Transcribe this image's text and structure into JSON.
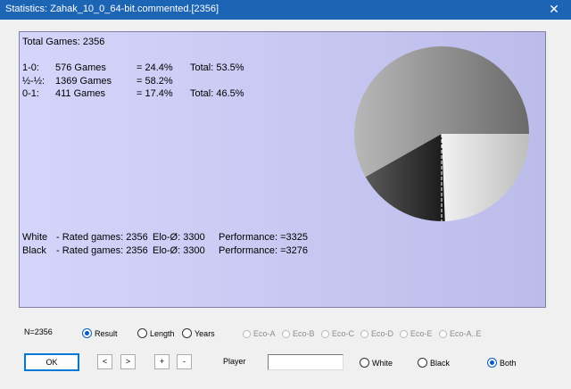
{
  "window": {
    "title": "Statistics: Zahak_10_0_64-bit.commented.[2356]",
    "close_label": "✕"
  },
  "stats": {
    "total_games": "Total Games: 2356",
    "rows": [
      {
        "result": "1-0:",
        "games": "576 Games",
        "pct": "= 24.4%",
        "total": "Total: 53.5%"
      },
      {
        "result": "½-½:",
        "games": "1369 Games",
        "pct": "= 58.2%",
        "total": ""
      },
      {
        "result": "0-1:",
        "games": "411 Games",
        "pct": "= 17.4%",
        "total": "Total: 46.5%"
      }
    ],
    "players": [
      {
        "side": "White",
        "rated": "- Rated games: 2356",
        "elo": "Elo-Ø: 3300",
        "perf": "Performance: =3325"
      },
      {
        "side": "Black",
        "rated": "- Rated games: 2356",
        "elo": "Elo-Ø: 3300",
        "perf": "Performance: =3276"
      }
    ]
  },
  "chart_data": {
    "type": "pie",
    "slices": [
      {
        "label": "1-0",
        "value": 24.4,
        "color": "#d9d9d9"
      },
      {
        "label": "0-1",
        "value": 17.4,
        "color": "#2e2e2e"
      },
      {
        "label": "½-½",
        "value": 58.2,
        "color": "#9a9a9a"
      }
    ]
  },
  "controls": {
    "count": "N=2356",
    "modes": [
      "Result",
      "Length",
      "Years"
    ],
    "mode_selected": "Result",
    "eco": [
      "Eco-A",
      "Eco-B",
      "Eco-C",
      "Eco-D",
      "Eco-E",
      "Eco-A..E"
    ],
    "ok": "OK",
    "prev": "<",
    "next": ">",
    "plus": "+",
    "minus": "-",
    "player_label": "Player",
    "player_value": "",
    "sides": [
      "White",
      "Black",
      "Both"
    ],
    "side_selected": "Both"
  }
}
